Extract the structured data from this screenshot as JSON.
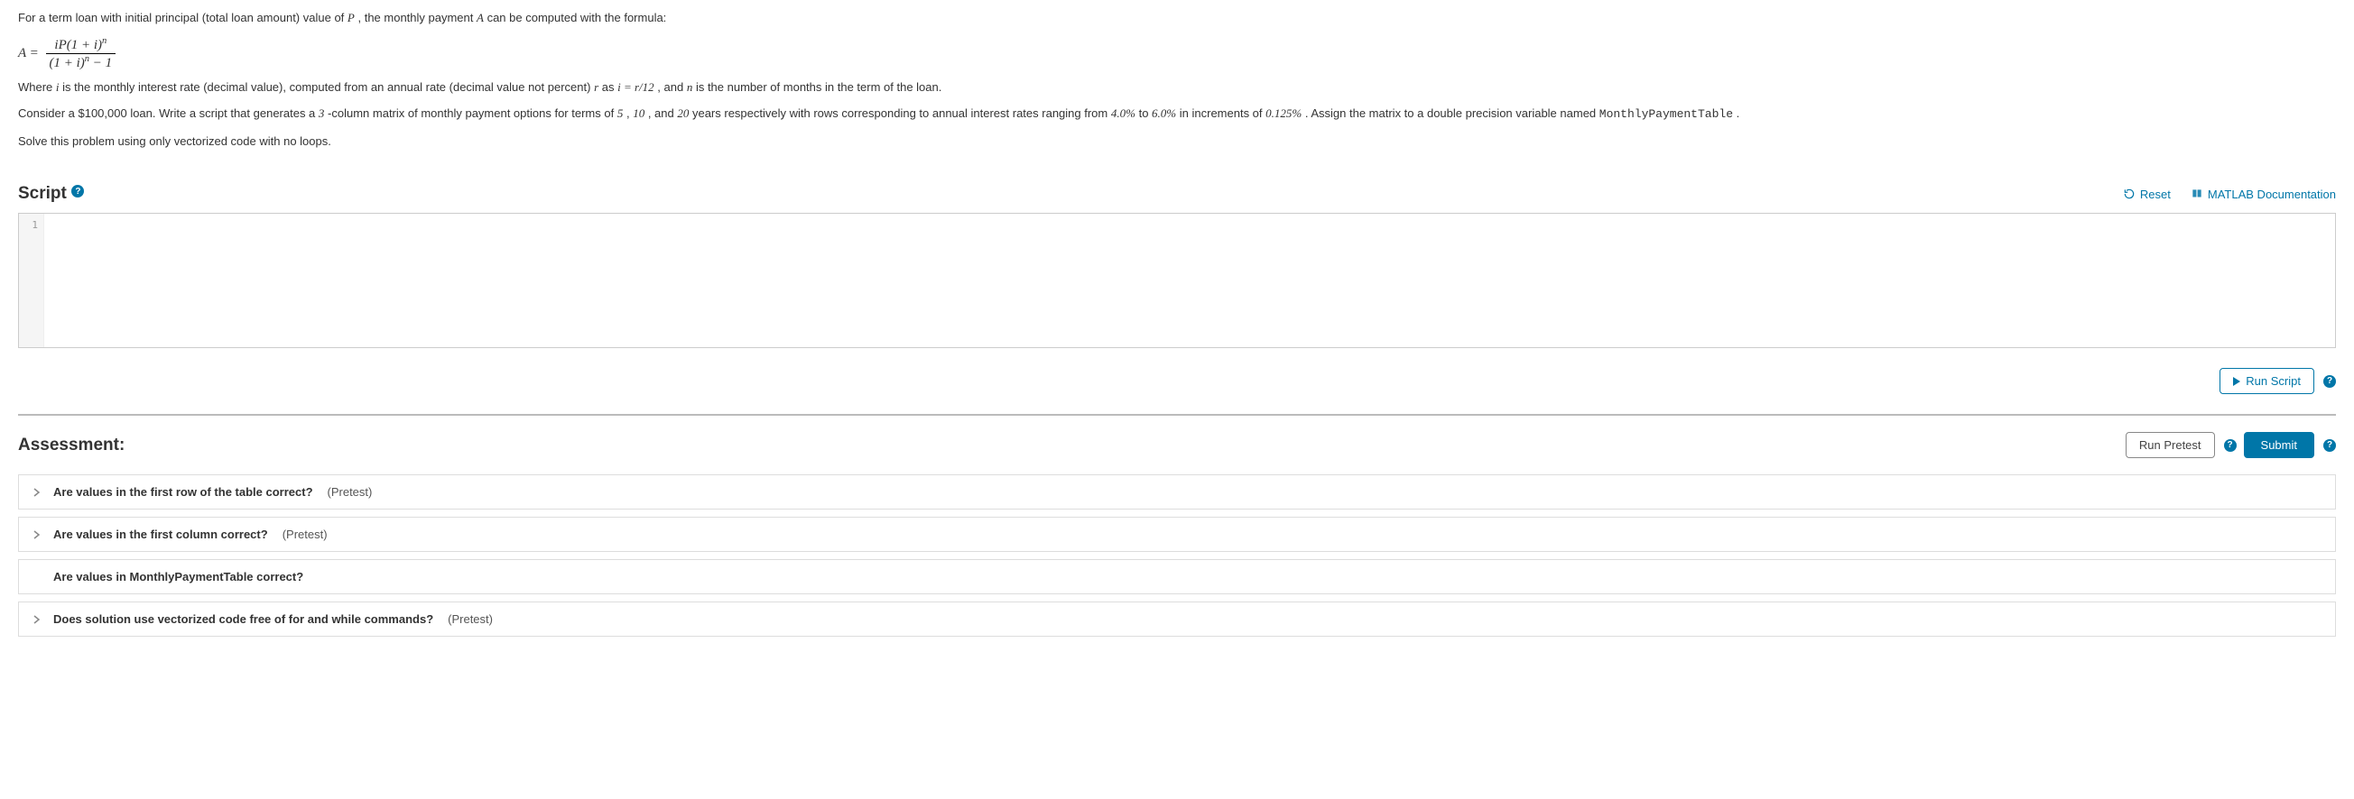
{
  "problem": {
    "line1_pre": "For a term loan with initial principal (total loan amount) value of ",
    "line1_var1": "P",
    "line1_mid": ", the monthly payment ",
    "line1_var2": "A",
    "line1_post": " can be computed with the formula:",
    "formula_lhs": "A = ",
    "formula_num": "iP(1 + i)",
    "formula_num_exp": "n",
    "formula_den": "(1 + i)",
    "formula_den_exp": "n",
    "formula_den_tail": " − 1",
    "line2_a": "Where ",
    "line2_i": "i",
    "line2_b": " is the monthly interest rate (decimal value), computed from an annual rate (decimal value not percent) ",
    "line2_r": "r",
    "line2_c": " as ",
    "line2_eq": "i = r/12",
    "line2_d": ", and ",
    "line2_n": "n",
    "line2_e": " is the number of months in the term of the loan.",
    "line3_a": "Consider a $100,000 loan. Write a script that generates a ",
    "line3_3": "3",
    "line3_b": "-column matrix of monthly payment options for terms of ",
    "line3_5": "5",
    "line3_c": ", ",
    "line3_10": "10",
    "line3_d": ", and ",
    "line3_20": "20",
    "line3_e": " years respectively with rows corresponding to annual interest rates ranging from ",
    "line3_lo": "4.0%",
    "line3_f": " to ",
    "line3_hi": "6.0%",
    "line3_g": " in increments of ",
    "line3_inc": "0.125%",
    "line3_h": ". Assign the matrix to a double precision variable named ",
    "line3_var": "MonthlyPaymentTable",
    "line3_i": ".",
    "line4": "Solve this problem using only vectorized code with no loops."
  },
  "script": {
    "title": "Script",
    "reset": "Reset",
    "docs": "MATLAB Documentation",
    "gutter1": "1",
    "run": "Run Script"
  },
  "assessment": {
    "title": "Assessment:",
    "pretest_btn": "Run Pretest",
    "submit": "Submit",
    "item1": "Are values in the first row of the table correct?",
    "item1_tag": "(Pretest)",
    "item2": "Are values in the first column correct?",
    "item2_tag": "(Pretest)",
    "item3": "Are values in MonthlyPaymentTable correct?",
    "item4": "Does solution use vectorized code free of for and while commands?",
    "item4_tag": "(Pretest)"
  }
}
